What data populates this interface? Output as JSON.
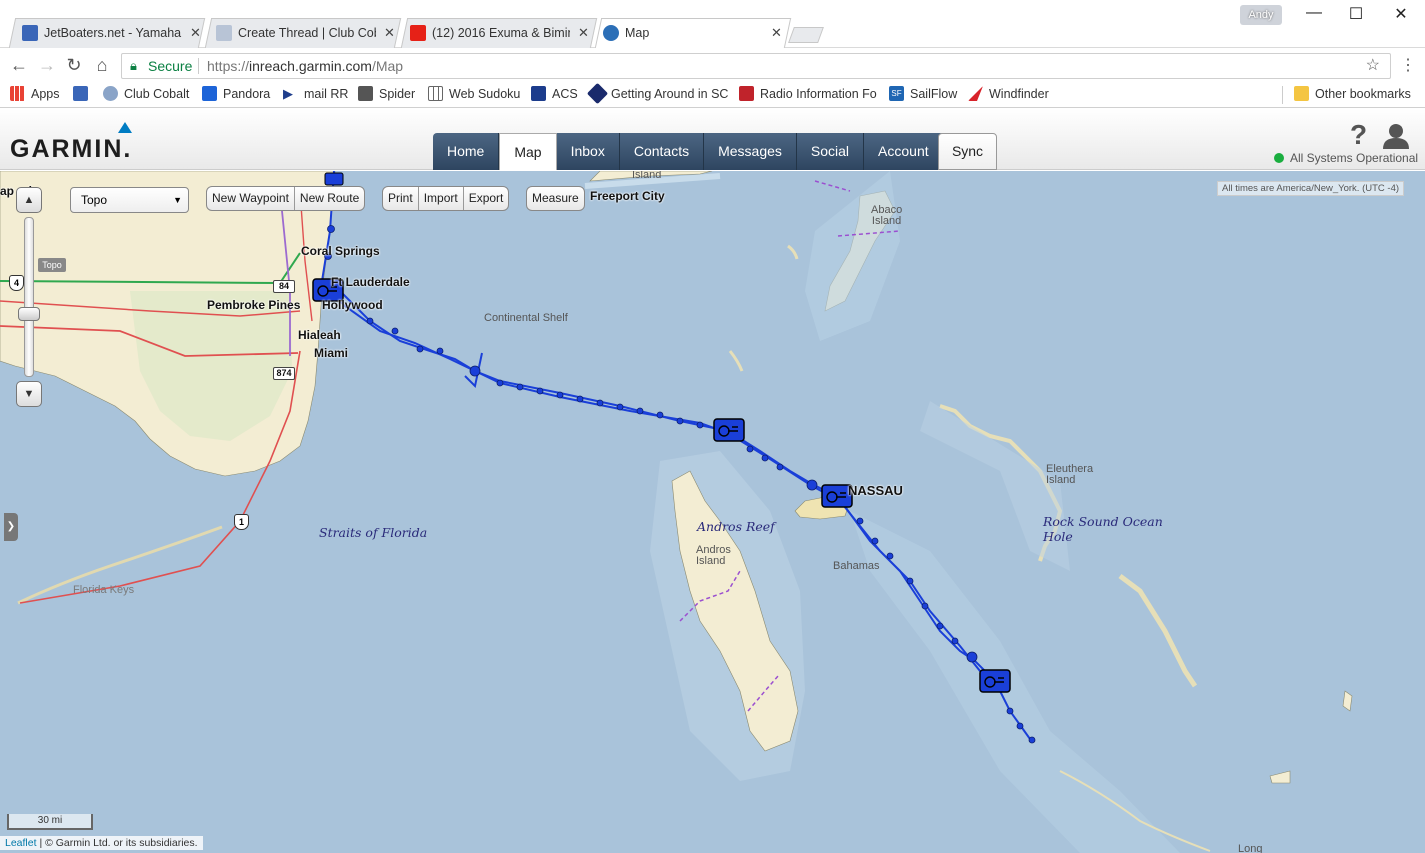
{
  "browser": {
    "tabs": [
      {
        "title": "JetBoaters.net - Yamaha",
        "icon": "jetboaters-favicon",
        "color": "#3a66b8"
      },
      {
        "title": "Create Thread | Club Cob",
        "icon": "clubcobalt-favicon",
        "color": "#999999"
      },
      {
        "title": "(12) 2016 Exuma & Bimin",
        "icon": "youtube-favicon",
        "color": "#e62117"
      },
      {
        "title": "Map",
        "icon": "globe-favicon",
        "color": "#2c6fb7"
      }
    ],
    "user": "Andy",
    "secure_label": "Secure",
    "url_scheme": "https://",
    "url_host": "inreach.garmin.com",
    "url_path": "/Map",
    "bookmarks": [
      {
        "label": "Apps",
        "icon": "apps-grid-icon",
        "color": "#4285f4"
      },
      {
        "label": "",
        "icon": "jetboaters-icon",
        "color": "#3a66b8"
      },
      {
        "label": "Club Cobalt",
        "icon": "clubcobalt-icon",
        "color": "#8aa4c8"
      },
      {
        "label": "Pandora",
        "icon": "pandora-icon",
        "color": "#1d64d8"
      },
      {
        "label": "mail RR",
        "icon": "play-arrow-icon",
        "color": "#1f3e8c"
      },
      {
        "label": "Spider",
        "icon": "spider-card-icon",
        "color": "#555555"
      },
      {
        "label": "Web Sudoku",
        "icon": "sudoku-grid-icon",
        "color": "#666666"
      },
      {
        "label": "ACS",
        "icon": "acs-icon",
        "color": "#1c3c8c"
      },
      {
        "label": "Getting Around in SC",
        "icon": "sc-icon",
        "color": "#1a2a6c"
      },
      {
        "label": "Radio Information Fo",
        "icon": "radio-info-icon",
        "color": "#c0232b"
      },
      {
        "label": "SailFlow",
        "icon": "sailflow-icon",
        "color": "#1f66b3"
      },
      {
        "label": "Windfinder",
        "icon": "windfinder-icon",
        "color": "#d8232a"
      }
    ],
    "other_bookmarks": "Other bookmarks"
  },
  "garmin": {
    "logo": "GARMIN.",
    "nav": [
      "Home",
      "Map",
      "Inbox",
      "Contacts",
      "Messages",
      "Social",
      "Account"
    ],
    "active_nav": "Map",
    "sync": "Sync",
    "status": "All Systems Operational",
    "status_color": "#1aae3f"
  },
  "map": {
    "layer_select": "Topo",
    "topo_tip": "Topo",
    "buttons_wp": [
      "New Waypoint",
      "New Route"
    ],
    "buttons_io": [
      "Print",
      "Import",
      "Export"
    ],
    "measure": "Measure",
    "timezone": "All times are America/New_York. (UTC -4)",
    "scale": "30 mi",
    "attribution_link": "Leaflet",
    "attribution_text": " | © Garmin Ltd. or its subsidiaries.",
    "labels": {
      "cape_coral": "ap      ral",
      "coral_springs": "Coral Springs",
      "ft_lauderdale": "Ft Lauderdale",
      "pembroke": "Pembroke Pines",
      "hollywood": "Hollywood",
      "hialeah": "Hialeah",
      "miami": "Miami",
      "freeport": "Freeport City",
      "island_top": "Island",
      "abaco": "Abaco\nIsland",
      "continental_shelf": "Continental Shelf",
      "nassau": "NASSAU",
      "andros_reef": "Andros Reef",
      "andros_island": "Andros\nIsland",
      "bahamas": "Bahamas",
      "eleuthera": "Eleuthera\nIsland",
      "rock_sound": "Rock Sound Ocean\nHole",
      "straits": "Straits of Florida",
      "florida_keys": "Florida Keys",
      "long": "Long",
      "route_84": "84",
      "route_874": "874",
      "route_1": "1",
      "route_4": "4"
    },
    "track_color": "#1a3fd8"
  }
}
